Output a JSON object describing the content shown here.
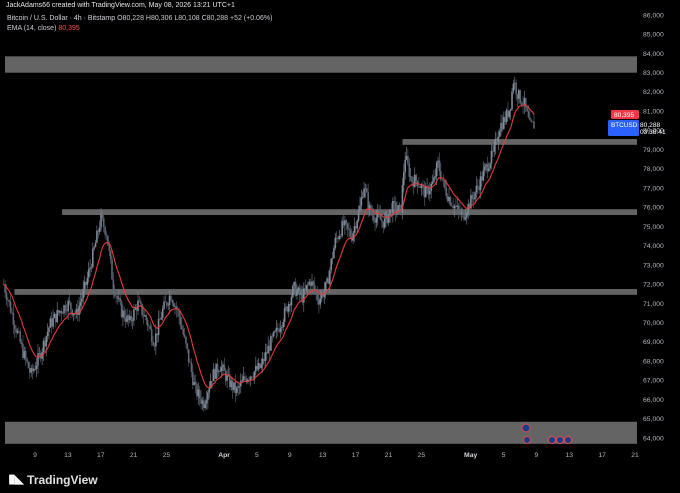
{
  "header": {
    "credit": "JackAdams66 created with TradingView.com, May 08, 2026 13:21 UTC+1"
  },
  "legend": {
    "title_line": "Bitcoin / U.S. Dollar · 4h · Bitstamp",
    "ohlc": "O80,228 H80,306 L80,108 C80,288 +52 (+0.06%)",
    "ema_label": "EMA (14, close)",
    "ema_value": "80,395"
  },
  "price_tags": {
    "ema": "80,395",
    "symbol": "BTCUSD",
    "price": "80,288",
    "countdown": "03:38:41"
  },
  "footer": {
    "brand": "TradingView"
  },
  "colors": {
    "background": "#000000",
    "candle": "#6f7b8a",
    "ema": "#e23b3b",
    "zone": "#8a8a8a",
    "price_tag": "#2962ff",
    "ema_tag": "#f23645"
  },
  "chart_data": {
    "type": "candlestick",
    "symbol": "Bitcoin / U.S. Dollar",
    "timeframe": "4h",
    "exchange": "Bitstamp",
    "y_ticks": [
      86000,
      85000,
      84000,
      83000,
      82000,
      81000,
      80000,
      79000,
      78000,
      77000,
      76000,
      75000,
      74000,
      73000,
      72000,
      71000,
      70000,
      69000,
      68000,
      67000,
      66000,
      65000,
      64000
    ],
    "y_tick_labels": [
      "86,000",
      "85,000",
      "84,000",
      "83,000",
      "82,000",
      "81,000",
      "80,000",
      "79,000",
      "78,000",
      "77,000",
      "76,000",
      "75,000",
      "74,000",
      "73,000",
      "72,000",
      "71,000",
      "70,000",
      "69,000",
      "68,000",
      "67,000",
      "66,000",
      "65,000",
      "64,000"
    ],
    "ylim": [
      63300,
      86000
    ],
    "x_tick_labels": [
      "9",
      "13",
      "17",
      "21",
      "25",
      "Apr",
      "5",
      "9",
      "13",
      "17",
      "21",
      "25",
      "May",
      "5",
      "9",
      "13",
      "17",
      "21"
    ],
    "x_tick_days": [
      0,
      4,
      8,
      12,
      16,
      23,
      27,
      31,
      35,
      39,
      43,
      47,
      53,
      57,
      61,
      65,
      69,
      73
    ],
    "xlim": [
      -3.8,
      76.5
    ],
    "zones": [
      {
        "x_start": -3.8,
        "y_low": 83000,
        "y_high": 83850
      },
      {
        "x_start": 44.7,
        "y_low": 79250,
        "y_high": 79550
      },
      {
        "x_start": 3.3,
        "y_low": 75600,
        "y_high": 75900
      },
      {
        "x_start": -2.5,
        "y_low": 71450,
        "y_high": 71750
      },
      {
        "x_start": -3.8,
        "y_low": 63700,
        "y_high": 64850
      }
    ],
    "close_path": [
      {
        "day": -3.8,
        "price": 72000
      },
      {
        "day": -2.5,
        "price": 70000
      },
      {
        "day": -1.5,
        "price": 68500
      },
      {
        "day": -0.5,
        "price": 67300
      },
      {
        "day": 0.5,
        "price": 68200
      },
      {
        "day": 1.8,
        "price": 69900
      },
      {
        "day": 3.0,
        "price": 70600
      },
      {
        "day": 4.0,
        "price": 71000
      },
      {
        "day": 5.0,
        "price": 70400
      },
      {
        "day": 6.2,
        "price": 72000
      },
      {
        "day": 7.2,
        "price": 73800
      },
      {
        "day": 8.0,
        "price": 75400
      },
      {
        "day": 8.7,
        "price": 74700
      },
      {
        "day": 9.5,
        "price": 72000
      },
      {
        "day": 10.5,
        "price": 70600
      },
      {
        "day": 11.5,
        "price": 70000
      },
      {
        "day": 12.5,
        "price": 71000
      },
      {
        "day": 13.5,
        "price": 70200
      },
      {
        "day": 14.5,
        "price": 69000
      },
      {
        "day": 15.5,
        "price": 70600
      },
      {
        "day": 16.5,
        "price": 71500
      },
      {
        "day": 17.5,
        "price": 70400
      },
      {
        "day": 18.5,
        "price": 68500
      },
      {
        "day": 19.5,
        "price": 66500
      },
      {
        "day": 20.5,
        "price": 65800
      },
      {
        "day": 21.5,
        "price": 67200
      },
      {
        "day": 22.5,
        "price": 67800
      },
      {
        "day": 23.5,
        "price": 67000
      },
      {
        "day": 24.5,
        "price": 66400
      },
      {
        "day": 25.5,
        "price": 67100
      },
      {
        "day": 26.5,
        "price": 67400
      },
      {
        "day": 27.5,
        "price": 67700
      },
      {
        "day": 28.5,
        "price": 68800
      },
      {
        "day": 29.5,
        "price": 69600
      },
      {
        "day": 30.5,
        "price": 70600
      },
      {
        "day": 31.5,
        "price": 71800
      },
      {
        "day": 32.5,
        "price": 71300
      },
      {
        "day": 33.5,
        "price": 72200
      },
      {
        "day": 34.5,
        "price": 71200
      },
      {
        "day": 35.5,
        "price": 71900
      },
      {
        "day": 36.5,
        "price": 74200
      },
      {
        "day": 37.5,
        "price": 75100
      },
      {
        "day": 38.5,
        "price": 74500
      },
      {
        "day": 39.5,
        "price": 75900
      },
      {
        "day": 40.0,
        "price": 77200
      },
      {
        "day": 40.8,
        "price": 75700
      },
      {
        "day": 41.5,
        "price": 75500
      },
      {
        "day": 42.5,
        "price": 75200
      },
      {
        "day": 43.5,
        "price": 76000
      },
      {
        "day": 44.5,
        "price": 75800
      },
      {
        "day": 45.0,
        "price": 78700
      },
      {
        "day": 45.8,
        "price": 77400
      },
      {
        "day": 46.5,
        "price": 77400
      },
      {
        "day": 47.5,
        "price": 76700
      },
      {
        "day": 48.5,
        "price": 77300
      },
      {
        "day": 49.0,
        "price": 78300
      },
      {
        "day": 49.8,
        "price": 77000
      },
      {
        "day": 50.5,
        "price": 76400
      },
      {
        "day": 51.3,
        "price": 75900
      },
      {
        "day": 52.0,
        "price": 75500
      },
      {
        "day": 53.0,
        "price": 76300
      },
      {
        "day": 54.0,
        "price": 77200
      },
      {
        "day": 55.0,
        "price": 78200
      },
      {
        "day": 55.8,
        "price": 78800
      },
      {
        "day": 56.5,
        "price": 80200
      },
      {
        "day": 57.2,
        "price": 80600
      },
      {
        "day": 57.8,
        "price": 81200
      },
      {
        "day": 58.2,
        "price": 82600
      },
      {
        "day": 58.8,
        "price": 81800
      },
      {
        "day": 59.5,
        "price": 81400
      },
      {
        "day": 60.2,
        "price": 80200
      },
      {
        "day": 60.7,
        "price": 80288
      }
    ],
    "last_price": 80288,
    "ema_last": 80395,
    "ema_period": 14
  }
}
